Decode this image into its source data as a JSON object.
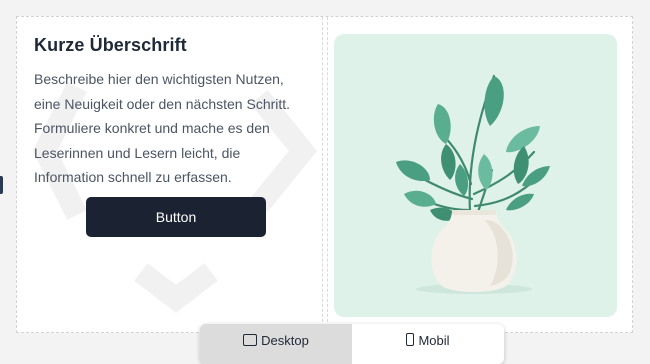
{
  "content": {
    "headline": "Kurze Überschrift",
    "body": "Beschreibe hier den wichtigsten Nutzen, eine Neuigkeit oder den nächsten Schritt. Formuliere konkret und mache es den Leserinnen und Lesern leicht, die Information schnell zu erfassen.",
    "button_label": "Button"
  },
  "illustration": {
    "subject": "plant-in-vase",
    "colors": {
      "background": "#dff2ea",
      "leaf": "#4a9f82",
      "vase": "#f4f1eb"
    }
  },
  "view_toggle": {
    "desktop_label": "Desktop",
    "mobile_label": "Mobil",
    "active": "mobile"
  }
}
